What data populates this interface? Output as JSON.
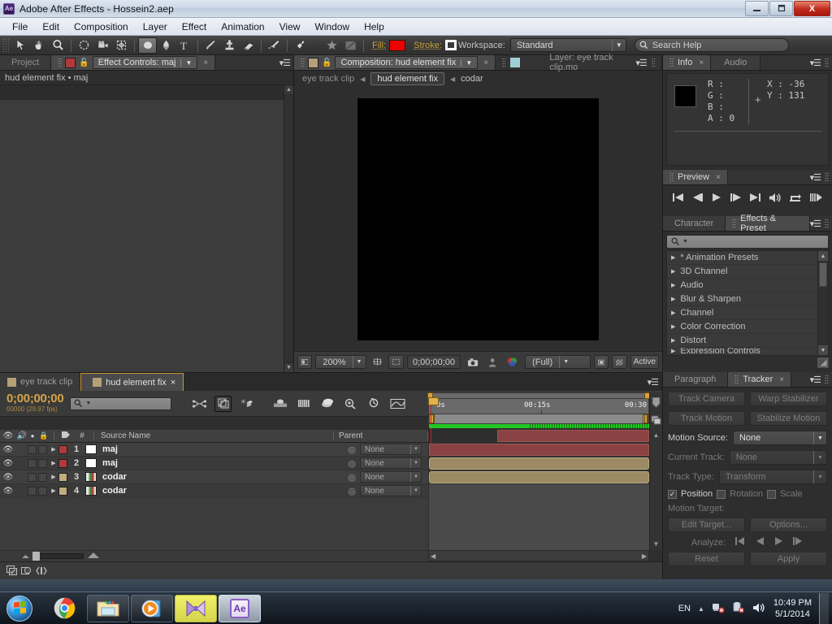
{
  "window": {
    "app_badge": "Ae",
    "title": "Adobe After Effects - Hossein2.aep",
    "minimize": "–",
    "restore": "❐",
    "close": "X"
  },
  "menubar": {
    "items": [
      "File",
      "Edit",
      "Composition",
      "Layer",
      "Effect",
      "Animation",
      "View",
      "Window",
      "Help"
    ]
  },
  "toolbar": {
    "tools": [
      {
        "name": "selection-tool",
        "glyph": "arrow"
      },
      {
        "name": "hand-tool",
        "glyph": "hand"
      },
      {
        "name": "zoom-tool",
        "glyph": "magnifier"
      },
      {
        "name": "rotation-tool",
        "glyph": "rotate"
      },
      {
        "name": "camera-tool",
        "glyph": "camera"
      },
      {
        "name": "pan-behind-tool",
        "glyph": "anchor"
      },
      {
        "name": "shape-tool",
        "glyph": "ellipse"
      },
      {
        "name": "pen-tool",
        "glyph": "pen"
      },
      {
        "name": "type-tool",
        "glyph": "type"
      },
      {
        "name": "brush-tool",
        "glyph": "brush"
      },
      {
        "name": "clone-stamp-tool",
        "glyph": "stamp"
      },
      {
        "name": "eraser-tool",
        "glyph": "eraser"
      },
      {
        "name": "roto-brush-tool",
        "glyph": "roto"
      },
      {
        "name": "puppet-pin-tool",
        "glyph": "pin"
      },
      {
        "name": "favorite-tool",
        "glyph": "star"
      },
      {
        "name": "mask-tool",
        "glyph": "maskbox"
      }
    ],
    "fill_label": "Fill:",
    "fill_color": "#ee0000",
    "stroke_label": "Stroke:",
    "stroke_color": "#ffffff",
    "workspace_label": "Workspace:",
    "workspace_value": "Standard",
    "search_help_placeholder": "Search Help"
  },
  "effect_controls": {
    "project_tab": "Project",
    "tab_title": "Effect Controls: maj",
    "close_x": "×",
    "breadcrumb": "hud element fix • maj"
  },
  "composition": {
    "tab_title": "Composition: hud element fix",
    "layer_tab_title": "Layer: eye track clip.mo",
    "close_x": "×",
    "breadcrumbs": [
      {
        "label": "eye track clip",
        "active": false
      },
      {
        "label": "hud element fix",
        "active": true
      },
      {
        "label": "codar",
        "active": false
      }
    ],
    "bottom_bar": {
      "zoom": "200%",
      "time": "0;00;00;00",
      "resolution": "(Full)",
      "active_label": "Active"
    }
  },
  "info_panel": {
    "tabs": [
      "Info",
      "Audio"
    ],
    "active_tab": "Info",
    "channels": [
      "R :",
      "G :",
      "B :",
      "A : 0"
    ],
    "x_value": "X : -36",
    "y_value": "Y : 131",
    "swatch_color": "#000000"
  },
  "preview_panel": {
    "tabs": [
      "Preview"
    ],
    "buttons": [
      {
        "name": "first-frame-button",
        "glyph": "|◀"
      },
      {
        "name": "previous-frame-button",
        "glyph": "◀|"
      },
      {
        "name": "play-button",
        "glyph": "▶"
      },
      {
        "name": "next-frame-button",
        "glyph": "|▶"
      },
      {
        "name": "last-frame-button",
        "glyph": "▶|"
      },
      {
        "name": "audio-toggle-button",
        "glyph": "🔊"
      },
      {
        "name": "loop-button",
        "glyph": "↻"
      },
      {
        "name": "ram-preview-button",
        "glyph": "|||▶"
      }
    ]
  },
  "effects_panel": {
    "tabs": [
      "Character",
      "Effects & Preset"
    ],
    "active_tab": "Effects & Preset",
    "search_placeholder": "",
    "categories": [
      "* Animation Presets",
      "3D Channel",
      "Audio",
      "Blur & Sharpen",
      "Channel",
      "Color Correction",
      "Distort",
      "Expression Controls"
    ]
  },
  "tracker_panel": {
    "tabs": [
      "Paragraph",
      "Tracker"
    ],
    "active_tab": "Tracker",
    "track_camera": "Track Camera",
    "warp_stabilizer": "Warp Stabilizer",
    "track_motion": "Track Motion",
    "stabilize_motion": "Stabilize Motion",
    "motion_source_label": "Motion Source:",
    "motion_source_value": "None",
    "current_track_label": "Current Track:",
    "current_track_value": "None",
    "track_type_label": "Track Type:",
    "track_type_value": "Transform",
    "position_label": "Position",
    "rotation_label": "Rotation",
    "scale_label": "Scale",
    "position_checked": true,
    "motion_target_label": "Motion Target:",
    "edit_target": "Edit Target...",
    "options": "Options...",
    "analyze_label": "Analyze:",
    "reset": "Reset",
    "apply": "Apply"
  },
  "timeline": {
    "tabs": [
      {
        "label": "eye track clip",
        "active": false
      },
      {
        "label": "hud element fix",
        "active": true
      }
    ],
    "close_x": "×",
    "current_time": "0;00;00;00",
    "frame_info": "00000 (29.97 fps)",
    "search_placeholder": "",
    "columns": {
      "source_name": "Source Name",
      "parent": "Parent",
      "hash": "#"
    },
    "layers": [
      {
        "num": "1",
        "name": "maj",
        "color": "#b03a3a",
        "parent": "None",
        "icon_type": "solid-white"
      },
      {
        "num": "2",
        "name": "maj",
        "color": "#b03a3a",
        "parent": "None",
        "icon_type": "solid-white"
      },
      {
        "num": "3",
        "name": "codar",
        "color": "#c2ab7e",
        "parent": "None",
        "icon_type": "footage"
      },
      {
        "num": "4",
        "name": "codar",
        "color": "#c2ab7e",
        "parent": "None",
        "icon_type": "footage"
      }
    ],
    "ruler_labels": [
      "0s",
      "00:15s",
      "00:30"
    ],
    "bars": [
      {
        "color": "#8a4242",
        "left_pct": 31,
        "width_pct": 69
      },
      {
        "color": "#8a4242",
        "left_pct": 0,
        "width_pct": 100
      },
      {
        "color": "#9b8a64",
        "left_pct": 0,
        "width_pct": 100
      },
      {
        "color": "#9b8a64",
        "left_pct": 0,
        "width_pct": 100
      }
    ]
  },
  "taskbar": {
    "start_label": "",
    "items": [
      {
        "name": "taskbar-chrome",
        "style": "normal"
      },
      {
        "name": "taskbar-explorer",
        "style": "normal"
      },
      {
        "name": "taskbar-media-player",
        "style": "normal"
      },
      {
        "name": "taskbar-video-editor",
        "style": "highlight"
      },
      {
        "name": "taskbar-after-effects",
        "style": "selected",
        "label": "Ae"
      }
    ],
    "language": "EN",
    "time": "10:49 PM",
    "date": "5/1/2014"
  }
}
